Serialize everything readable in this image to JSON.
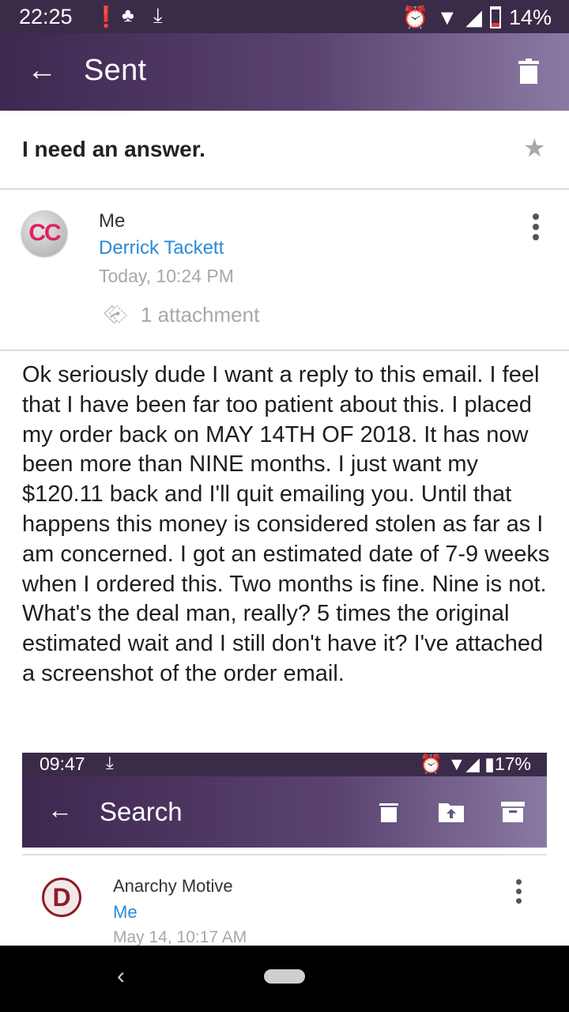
{
  "status_bar": {
    "time": "22:25",
    "battery": "14%"
  },
  "app_bar": {
    "title": "Sent"
  },
  "message": {
    "subject": "I need an answer.",
    "from": "Me",
    "to": "Derrick Tackett",
    "date": "Today, 10:24 PM",
    "attachments": "1 attachment",
    "avatar_initials": "CC",
    "body": "Ok seriously dude I want a reply to this email. I feel that I have been far too patient about this. I placed my order back on MAY 14TH OF 2018. It has now been more than NINE months. I just want my $120.11 back and I'll quit emailing you. Until that happens this money is considered stolen as far as I am concerned. I got an estimated date of 7-9 weeks when I ordered this. Two months is fine. Nine is not. What's the deal man, really? 5 times the original estimated wait and I still don't have it? I've attached a screenshot of the order email."
  },
  "attachment_preview": {
    "status_time": "09:47",
    "status_battery": "17%",
    "title": "Search",
    "from": "Anarchy Motive",
    "to": "Me",
    "date": "May 14, 10:17 AM",
    "avatar_letter": "D"
  },
  "colors": {
    "app_bar_dark": "#3d2850",
    "app_bar_light": "#8a7aa3",
    "link_blue": "#2a8ad8",
    "avatar_pink": "#e3205f"
  },
  "icons": [
    "back-arrow-icon",
    "trash-icon",
    "star-icon",
    "more-vert-icon",
    "paperclip-icon",
    "folder-move-icon",
    "archive-icon",
    "alarm-icon",
    "wifi-icon",
    "signal-icon",
    "battery-icon",
    "download-icon"
  ]
}
